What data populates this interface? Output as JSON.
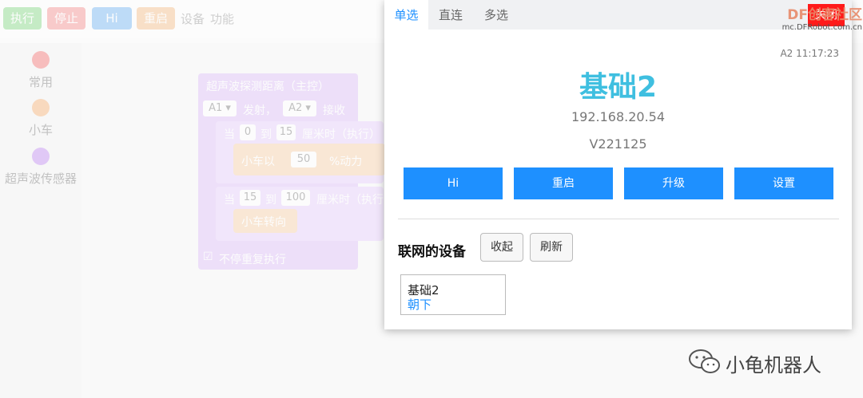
{
  "toolbar": {
    "buttons": [
      {
        "label": "执行",
        "color": "#6ed36e"
      },
      {
        "label": "停止",
        "color": "#f47b7b"
      },
      {
        "label": "Hi",
        "color": "#5aa8f2"
      },
      {
        "label": "重启",
        "color": "#f5b375"
      }
    ],
    "menu_device": "设备",
    "menu_function": "功能"
  },
  "sidebar": {
    "categories": [
      {
        "label": "常用",
        "color": "#f25b5b"
      },
      {
        "label": "小车",
        "color": "#f5a35c"
      },
      {
        "label": "超声波传感器",
        "color": "#b678f0"
      }
    ]
  },
  "blocks": {
    "hat": "超声波探测距离（主控）",
    "port_a": "A1",
    "send": "发射，",
    "port_b": "A2",
    "receive": "接收",
    "when": "当",
    "range1_min": "0",
    "to": "到",
    "range1_max": "15",
    "cm_exec": "厘米时（执行）",
    "car_with": "小车以",
    "power": "50",
    "power_unit": "%动力",
    "range2_min": "15",
    "range2_max": "100",
    "cm_exec2": "厘米时（执行",
    "car_turn": "小车转向",
    "loop": "不停重复执行"
  },
  "panel": {
    "tabs": [
      "单选",
      "直连",
      "多选"
    ],
    "active_tab": "单选",
    "close_label": "关闭",
    "watermark_top": "DF创客社区",
    "watermark_bottom": "mc.DFRobot.com.cn",
    "timestamp": "A2 11:17:23",
    "device_title": "基础2",
    "ip": "192.168.20.54",
    "version": "V221125",
    "actions": [
      "Hi",
      "重启",
      "升级",
      "设置"
    ],
    "section_title": "联网的设备",
    "collapse_label": "收起",
    "refresh_label": "刷新",
    "device_card": {
      "name": "基础2",
      "status": "朝下"
    },
    "accent": "#1e90ff",
    "title_color": "#3fbfe0",
    "close_color": "#ff1a1a"
  },
  "credit": {
    "icon": "wechat-icon",
    "text": "小龟机器人"
  }
}
